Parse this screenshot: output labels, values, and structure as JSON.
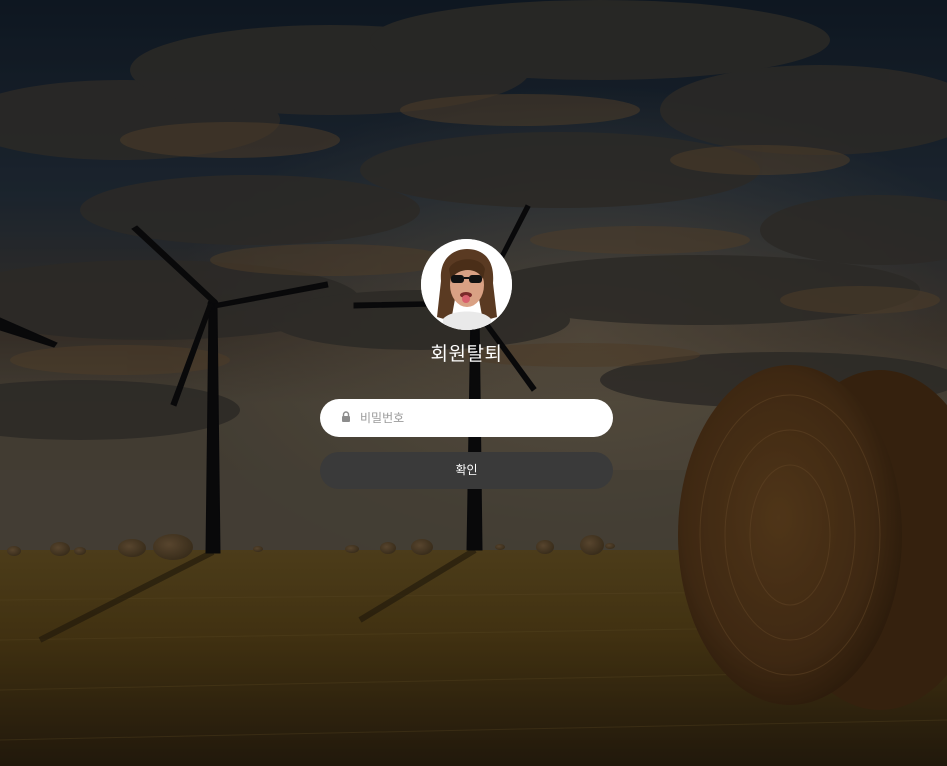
{
  "page": {
    "title": "회원탈퇴"
  },
  "form": {
    "password_placeholder": "비밀번호",
    "password_value": "",
    "confirm_label": "확인"
  },
  "icons": {
    "lock": "lock-icon",
    "avatar": "avatar"
  },
  "colors": {
    "button_bg": "#3a3a3a",
    "field_bg": "#ffffff",
    "title_text": "#ffffff"
  }
}
